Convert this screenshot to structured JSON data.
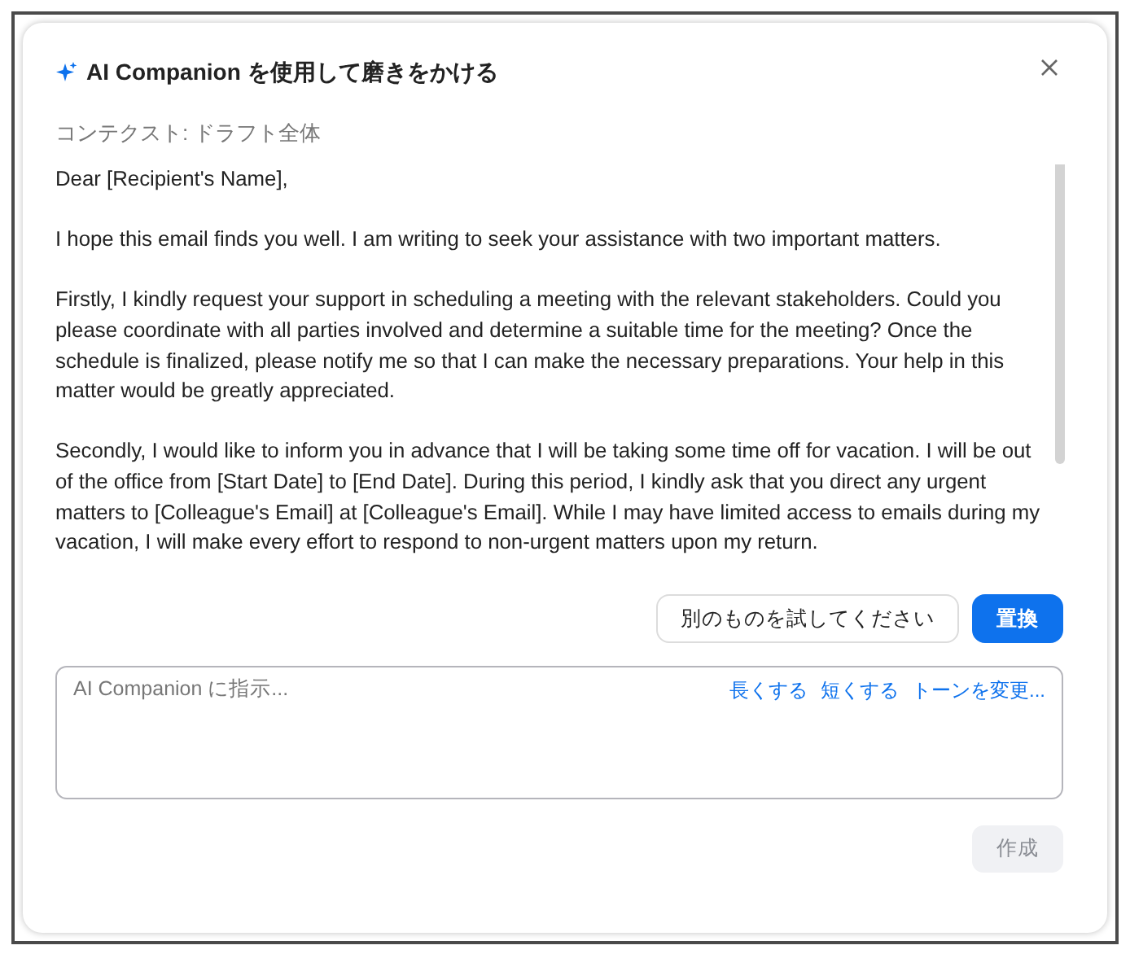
{
  "dialog": {
    "title": "AI Companion を使用して磨きをかける",
    "context": "コンテクスト: ドラフト全体",
    "paragraphs": [
      "Dear [Recipient's Name],",
      "I hope this email finds you well. I am writing to seek your assistance with two important matters.",
      "Firstly, I kindly request your support in scheduling a meeting with the relevant stakeholders. Could you please coordinate with all parties involved and determine a suitable time for the meeting? Once the schedule is finalized, please notify me so that I can make the necessary preparations. Your help in this matter would be greatly appreciated.",
      "Secondly, I would like to inform you in advance that I will be taking some time off for vacation. I will be out of the office from [Start Date] to [End Date]. During this period, I kindly ask that you direct any urgent matters to [Colleague's Email] at [Colleague's Email]. While I may have limited access to emails during my vacation, I will make every effort to respond to non-urgent matters upon my return."
    ],
    "actions": [
      {
        "label": "別のものを試してください",
        "kind": "secondary"
      },
      {
        "label": "置換",
        "kind": "primary"
      }
    ],
    "prompt": {
      "placeholder": "AI Companion に指示...",
      "suggestions": [
        "長くする",
        "短くする",
        "トーンを変更..."
      ]
    },
    "submit": {
      "label": "作成",
      "disabled": true
    }
  }
}
